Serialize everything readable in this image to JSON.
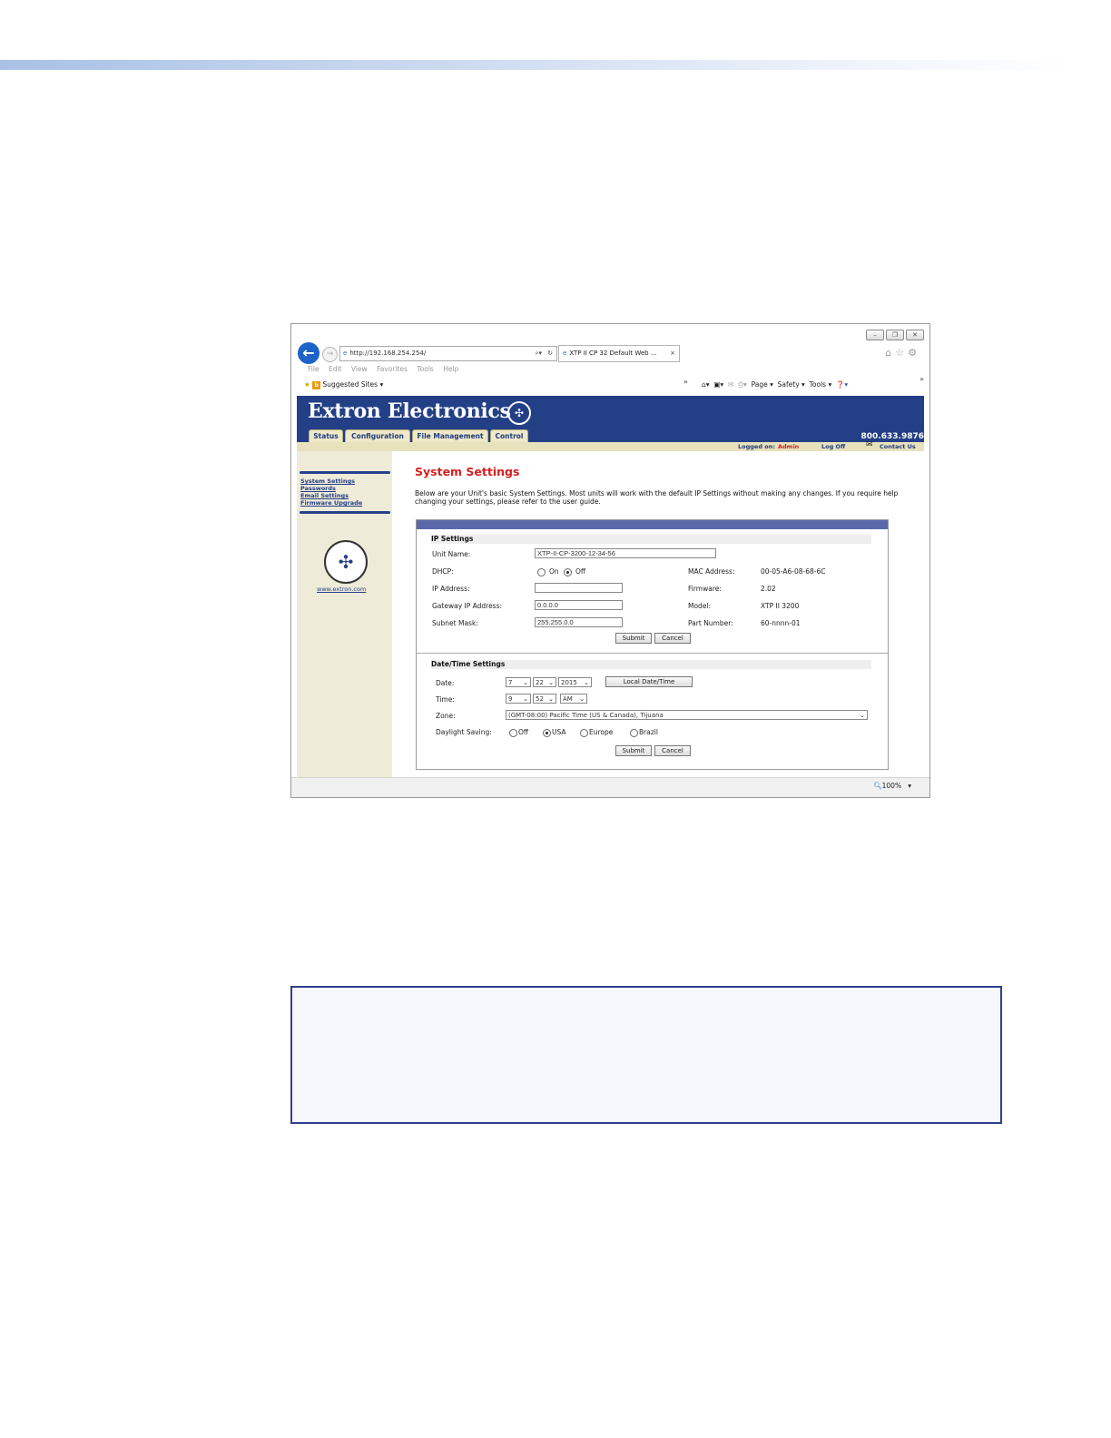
{
  "browser": {
    "url": "http://192.168.254.254/",
    "tab_title": "XTP II CP 32 Default Web ...",
    "tab_close": "×",
    "menu": [
      "File",
      "Edit",
      "View",
      "Favorites",
      "Tools",
      "Help"
    ],
    "favorites_label": "Suggested Sites ▾",
    "command_bar": [
      "Page ▾",
      "Safety ▾",
      "Tools ▾"
    ],
    "chevron": "»",
    "zoom": "100%",
    "zoom_caret": "▾"
  },
  "site": {
    "brand": "Extron Electronics",
    "phone": "800.633.9876",
    "tabs": [
      "Status",
      "Configuration",
      "File Management",
      "Control"
    ],
    "logged_on_label": "Logged on:",
    "logged_on_user": "Admin",
    "log_off": "Log Off",
    "contact": "Contact Us"
  },
  "sidebar": {
    "links": [
      "System Settings",
      "Passwords",
      "Email Settings",
      "Firmware Upgrade"
    ],
    "url": "www.extron.com"
  },
  "page": {
    "title": "System Settings",
    "description": "Below are your Unit's basic System Settings. Most units will work with the default IP Settings without making any changes. If you require help changing your settings, please refer to the user guide."
  },
  "ip_settings": {
    "header": "IP Settings",
    "unit_name_label": "Unit Name:",
    "unit_name_value": "XTP-II-CP-3200-12-34-56",
    "dhcp_label": "DHCP:",
    "dhcp_on": "On",
    "dhcp_off": "Off",
    "ip_label": "IP Address:",
    "ip_value": "",
    "gateway_label": "Gateway IP Address:",
    "gateway_value": "0.0.0.0",
    "subnet_label": "Subnet Mask:",
    "subnet_value": "255.255.0.0",
    "mac_label": "MAC Address:",
    "mac_value": "00-05-A6-08-68-6C",
    "firmware_label": "Firmware:",
    "firmware_value": "2.02",
    "model_label": "Model:",
    "model_value": "XTP II 3200",
    "part_label": "Part Number:",
    "part_value": "60-nnnn-01",
    "submit": "Submit",
    "cancel": "Cancel"
  },
  "datetime": {
    "header": "Date/Time Settings",
    "date_label": "Date:",
    "month": "7",
    "day": "22",
    "year": "2015",
    "local_btn": "Local Date/Time",
    "time_label": "Time:",
    "hour": "9",
    "minute": "52",
    "ampm": "AM",
    "zone_label": "Zone:",
    "zone_value": "(GMT-08:00) Pacific Time (US & Canada), Tijuana",
    "dst_label": "Daylight Saving:",
    "dst_options": [
      "Off",
      "USA",
      "Europe",
      "Brazil"
    ],
    "submit": "Submit",
    "cancel": "Cancel"
  }
}
